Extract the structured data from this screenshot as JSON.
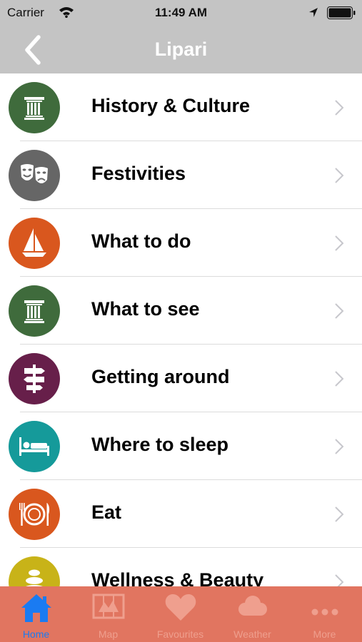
{
  "status": {
    "carrier": "Carrier",
    "time": "11:49 AM"
  },
  "nav": {
    "title": "Lipari"
  },
  "colors": {
    "chrome": "#c4c4c4",
    "tab_bar": "#e17560",
    "active_tab": "#1a7bf2",
    "inactive_tab": "#ef9f8e"
  },
  "menu": [
    {
      "label": "History & Culture",
      "icon": "column-icon",
      "color": "#3f6b3c"
    },
    {
      "label": "Festivities",
      "icon": "theatre-masks-icon",
      "color": "#666666"
    },
    {
      "label": "What to do",
      "icon": "sailboat-icon",
      "color": "#d9571e"
    },
    {
      "label": "What to see",
      "icon": "column-icon",
      "color": "#3f6b3c"
    },
    {
      "label": "Getting around",
      "icon": "signpost-icon",
      "color": "#671f4a"
    },
    {
      "label": "Where to sleep",
      "icon": "bed-icon",
      "color": "#159a9a"
    },
    {
      "label": "Eat",
      "icon": "plate-cutlery-icon",
      "color": "#d9571e"
    },
    {
      "label": "Wellness & Beauty",
      "icon": "spa-stones-icon",
      "color": "#c8b318"
    }
  ],
  "tabs": [
    {
      "label": "Home",
      "icon": "home-icon",
      "active": true
    },
    {
      "label": "Map",
      "icon": "map-icon",
      "active": false
    },
    {
      "label": "Favourites",
      "icon": "heart-icon",
      "active": false
    },
    {
      "label": "Weather",
      "icon": "cloud-icon",
      "active": false
    },
    {
      "label": "More",
      "icon": "more-dots-icon",
      "active": false
    }
  ]
}
